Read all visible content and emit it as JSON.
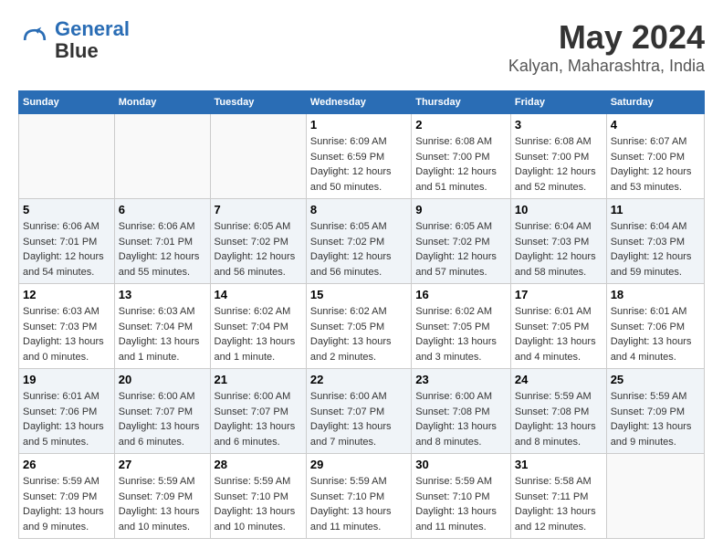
{
  "logo": {
    "line1": "General",
    "line2": "Blue"
  },
  "title": "May 2024",
  "subtitle": "Kalyan, Maharashtra, India",
  "days_header": [
    "Sunday",
    "Monday",
    "Tuesday",
    "Wednesday",
    "Thursday",
    "Friday",
    "Saturday"
  ],
  "weeks": [
    [
      {
        "day": "",
        "sunrise": "",
        "sunset": "",
        "daylight": ""
      },
      {
        "day": "",
        "sunrise": "",
        "sunset": "",
        "daylight": ""
      },
      {
        "day": "",
        "sunrise": "",
        "sunset": "",
        "daylight": ""
      },
      {
        "day": "1",
        "sunrise": "Sunrise: 6:09 AM",
        "sunset": "Sunset: 6:59 PM",
        "daylight": "Daylight: 12 hours and 50 minutes."
      },
      {
        "day": "2",
        "sunrise": "Sunrise: 6:08 AM",
        "sunset": "Sunset: 7:00 PM",
        "daylight": "Daylight: 12 hours and 51 minutes."
      },
      {
        "day": "3",
        "sunrise": "Sunrise: 6:08 AM",
        "sunset": "Sunset: 7:00 PM",
        "daylight": "Daylight: 12 hours and 52 minutes."
      },
      {
        "day": "4",
        "sunrise": "Sunrise: 6:07 AM",
        "sunset": "Sunset: 7:00 PM",
        "daylight": "Daylight: 12 hours and 53 minutes."
      }
    ],
    [
      {
        "day": "5",
        "sunrise": "Sunrise: 6:06 AM",
        "sunset": "Sunset: 7:01 PM",
        "daylight": "Daylight: 12 hours and 54 minutes."
      },
      {
        "day": "6",
        "sunrise": "Sunrise: 6:06 AM",
        "sunset": "Sunset: 7:01 PM",
        "daylight": "Daylight: 12 hours and 55 minutes."
      },
      {
        "day": "7",
        "sunrise": "Sunrise: 6:05 AM",
        "sunset": "Sunset: 7:02 PM",
        "daylight": "Daylight: 12 hours and 56 minutes."
      },
      {
        "day": "8",
        "sunrise": "Sunrise: 6:05 AM",
        "sunset": "Sunset: 7:02 PM",
        "daylight": "Daylight: 12 hours and 56 minutes."
      },
      {
        "day": "9",
        "sunrise": "Sunrise: 6:05 AM",
        "sunset": "Sunset: 7:02 PM",
        "daylight": "Daylight: 12 hours and 57 minutes."
      },
      {
        "day": "10",
        "sunrise": "Sunrise: 6:04 AM",
        "sunset": "Sunset: 7:03 PM",
        "daylight": "Daylight: 12 hours and 58 minutes."
      },
      {
        "day": "11",
        "sunrise": "Sunrise: 6:04 AM",
        "sunset": "Sunset: 7:03 PM",
        "daylight": "Daylight: 12 hours and 59 minutes."
      }
    ],
    [
      {
        "day": "12",
        "sunrise": "Sunrise: 6:03 AM",
        "sunset": "Sunset: 7:03 PM",
        "daylight": "Daylight: 13 hours and 0 minutes."
      },
      {
        "day": "13",
        "sunrise": "Sunrise: 6:03 AM",
        "sunset": "Sunset: 7:04 PM",
        "daylight": "Daylight: 13 hours and 1 minute."
      },
      {
        "day": "14",
        "sunrise": "Sunrise: 6:02 AM",
        "sunset": "Sunset: 7:04 PM",
        "daylight": "Daylight: 13 hours and 1 minute."
      },
      {
        "day": "15",
        "sunrise": "Sunrise: 6:02 AM",
        "sunset": "Sunset: 7:05 PM",
        "daylight": "Daylight: 13 hours and 2 minutes."
      },
      {
        "day": "16",
        "sunrise": "Sunrise: 6:02 AM",
        "sunset": "Sunset: 7:05 PM",
        "daylight": "Daylight: 13 hours and 3 minutes."
      },
      {
        "day": "17",
        "sunrise": "Sunrise: 6:01 AM",
        "sunset": "Sunset: 7:05 PM",
        "daylight": "Daylight: 13 hours and 4 minutes."
      },
      {
        "day": "18",
        "sunrise": "Sunrise: 6:01 AM",
        "sunset": "Sunset: 7:06 PM",
        "daylight": "Daylight: 13 hours and 4 minutes."
      }
    ],
    [
      {
        "day": "19",
        "sunrise": "Sunrise: 6:01 AM",
        "sunset": "Sunset: 7:06 PM",
        "daylight": "Daylight: 13 hours and 5 minutes."
      },
      {
        "day": "20",
        "sunrise": "Sunrise: 6:00 AM",
        "sunset": "Sunset: 7:07 PM",
        "daylight": "Daylight: 13 hours and 6 minutes."
      },
      {
        "day": "21",
        "sunrise": "Sunrise: 6:00 AM",
        "sunset": "Sunset: 7:07 PM",
        "daylight": "Daylight: 13 hours and 6 minutes."
      },
      {
        "day": "22",
        "sunrise": "Sunrise: 6:00 AM",
        "sunset": "Sunset: 7:07 PM",
        "daylight": "Daylight: 13 hours and 7 minutes."
      },
      {
        "day": "23",
        "sunrise": "Sunrise: 6:00 AM",
        "sunset": "Sunset: 7:08 PM",
        "daylight": "Daylight: 13 hours and 8 minutes."
      },
      {
        "day": "24",
        "sunrise": "Sunrise: 5:59 AM",
        "sunset": "Sunset: 7:08 PM",
        "daylight": "Daylight: 13 hours and 8 minutes."
      },
      {
        "day": "25",
        "sunrise": "Sunrise: 5:59 AM",
        "sunset": "Sunset: 7:09 PM",
        "daylight": "Daylight: 13 hours and 9 minutes."
      }
    ],
    [
      {
        "day": "26",
        "sunrise": "Sunrise: 5:59 AM",
        "sunset": "Sunset: 7:09 PM",
        "daylight": "Daylight: 13 hours and 9 minutes."
      },
      {
        "day": "27",
        "sunrise": "Sunrise: 5:59 AM",
        "sunset": "Sunset: 7:09 PM",
        "daylight": "Daylight: 13 hours and 10 minutes."
      },
      {
        "day": "28",
        "sunrise": "Sunrise: 5:59 AM",
        "sunset": "Sunset: 7:10 PM",
        "daylight": "Daylight: 13 hours and 10 minutes."
      },
      {
        "day": "29",
        "sunrise": "Sunrise: 5:59 AM",
        "sunset": "Sunset: 7:10 PM",
        "daylight": "Daylight: 13 hours and 11 minutes."
      },
      {
        "day": "30",
        "sunrise": "Sunrise: 5:59 AM",
        "sunset": "Sunset: 7:10 PM",
        "daylight": "Daylight: 13 hours and 11 minutes."
      },
      {
        "day": "31",
        "sunrise": "Sunrise: 5:58 AM",
        "sunset": "Sunset: 7:11 PM",
        "daylight": "Daylight: 13 hours and 12 minutes."
      },
      {
        "day": "",
        "sunrise": "",
        "sunset": "",
        "daylight": ""
      }
    ]
  ]
}
